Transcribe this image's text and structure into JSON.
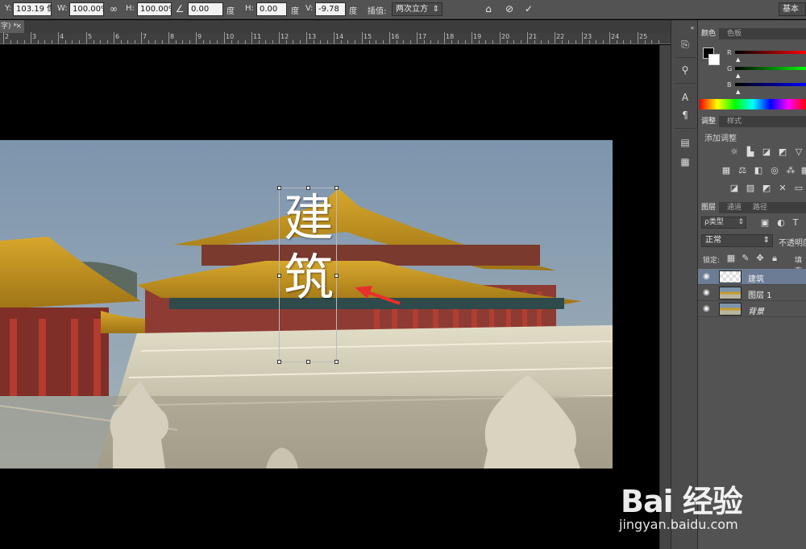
{
  "options_bar": {
    "y_label": "Y:",
    "y_value": "103.19 像!",
    "w_label": "W:",
    "w_value": "100.00%",
    "link_icon": "link-icon",
    "h_label": "H:",
    "h_value": "100.00%",
    "angle_icon": "angle-icon",
    "angle_value": "0.00",
    "angle_unit": "度",
    "hskew_label": "H:",
    "hskew_value": "0.00",
    "hskew_unit": "度",
    "vskew_label": "V:",
    "vskew_value": "-9.78",
    "vskew_unit": "度",
    "interp_label": "插值:",
    "interp_value": "两次立方",
    "workspace": "基本"
  },
  "document_tab": {
    "title": "字) *",
    "close": "×"
  },
  "ruler": {
    "labels": [
      "2",
      "3",
      "4",
      "5",
      "6",
      "7",
      "8",
      "9",
      "10",
      "11",
      "12",
      "13",
      "14",
      "15",
      "16",
      "17",
      "18",
      "19",
      "20",
      "21",
      "22",
      "23",
      "24",
      "25"
    ]
  },
  "canvas": {
    "text_line1": "建",
    "text_line2": "筑"
  },
  "color_panel": {
    "tabs": [
      "颜色",
      "色板"
    ],
    "channels": [
      "R",
      "G",
      "B"
    ],
    "colors": {
      "fg": "#000000",
      "bg": "#ffffff"
    }
  },
  "adjust_panel": {
    "tabs": [
      "调整",
      "样式"
    ],
    "title": "添加调整"
  },
  "layers_panel": {
    "tabs": [
      "图层",
      "通道",
      "路径"
    ],
    "kind": "ρ类型",
    "blend_mode": "正常",
    "opacity_label": "不透明度",
    "lock_label": "锁定:",
    "fill_label": "填充",
    "layers": [
      {
        "name": "建筑",
        "selected": true
      },
      {
        "name": "图层 1",
        "selected": false
      },
      {
        "name": "背景",
        "selected": false
      }
    ]
  },
  "watermark": {
    "brand": "Bai 经验",
    "url": "jingyan.baidu.com"
  }
}
